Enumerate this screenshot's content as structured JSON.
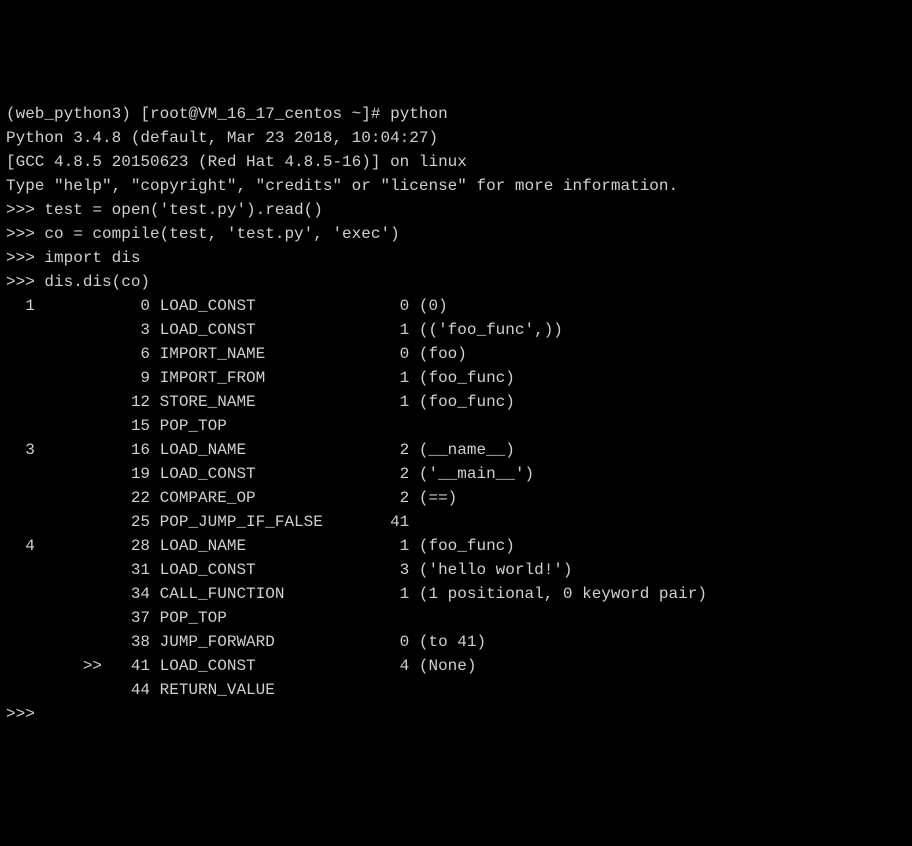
{
  "prompt": {
    "env": "(web_python3)",
    "user_host": "[root@VM_16_17_centos ~]#",
    "command": "python"
  },
  "banner": {
    "line1": "Python 3.4.8 (default, Mar 23 2018, 10:04:27)",
    "line2": "[GCC 4.8.5 20150623 (Red Hat 4.8.5-16)] on linux",
    "line3": "Type \"help\", \"copyright\", \"credits\" or \"license\" for more information."
  },
  "repl": {
    "cmd1": ">>> test = open('test.py').read()",
    "cmd2": ">>> co = compile(test, 'test.py', 'exec')",
    "cmd3": ">>> import dis",
    "cmd4": ">>> dis.dis(co)"
  },
  "dis": {
    "l01": "  1           0 LOAD_CONST               0 (0)",
    "l02": "              3 LOAD_CONST               1 (('foo_func',))",
    "l03": "              6 IMPORT_NAME              0 (foo)",
    "l04": "              9 IMPORT_FROM              1 (foo_func)",
    "l05": "             12 STORE_NAME               1 (foo_func)",
    "l06": "             15 POP_TOP",
    "l07": "",
    "l08": "  3          16 LOAD_NAME                2 (__name__)",
    "l09": "             19 LOAD_CONST               2 ('__main__')",
    "l10": "             22 COMPARE_OP               2 (==)",
    "l11": "             25 POP_JUMP_IF_FALSE       41",
    "l12": "",
    "l13": "  4          28 LOAD_NAME                1 (foo_func)",
    "l14": "             31 LOAD_CONST               3 ('hello world!')",
    "l15": "             34 CALL_FUNCTION            1 (1 positional, 0 keyword pair)",
    "l16": "             37 POP_TOP",
    "l17": "             38 JUMP_FORWARD             0 (to 41)",
    "l18": "        >>   41 LOAD_CONST               4 (None)",
    "l19": "             44 RETURN_VALUE"
  },
  "final_prompt": ">>> "
}
